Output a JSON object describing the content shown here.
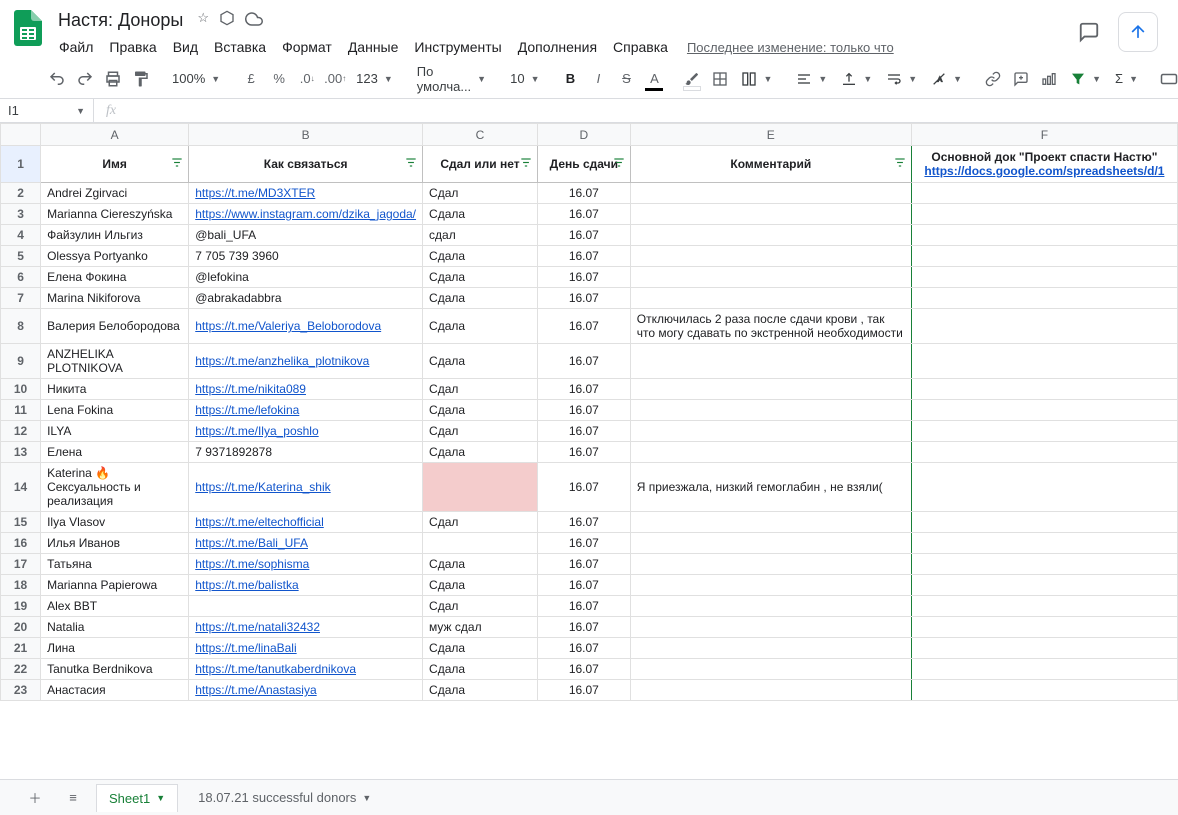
{
  "doc": {
    "title": "Настя: Доноры",
    "last_edit": "Последнее изменение: только что"
  },
  "menus": [
    "Файл",
    "Правка",
    "Вид",
    "Вставка",
    "Формат",
    "Данные",
    "Инструменты",
    "Дополнения",
    "Справка"
  ],
  "toolbar": {
    "zoom": "100%",
    "font": "По умолча...",
    "font_size": "10"
  },
  "formula": {
    "cell_ref": "I1",
    "value": ""
  },
  "columns": [
    "A",
    "B",
    "C",
    "D",
    "E",
    "F"
  ],
  "headers": {
    "A": "Имя",
    "B": "Как связаться",
    "C": "Сдал или нет",
    "D": "День сдачи",
    "E": "Комментарий",
    "F_line1": "Основной док \"Проект спасти Настю\"",
    "F_line2": "https://docs.google.com/spreadsheets/d/1"
  },
  "rows": [
    {
      "n": 2,
      "A": "Andrei Zgirvaci",
      "B": "https://t.me/MD3XTER",
      "B_link": true,
      "C": "Сдал",
      "D": "16.07",
      "E": ""
    },
    {
      "n": 3,
      "A": "Marianna Ciereszyńska",
      "B": "https://www.instagram.com/dzika_jagoda/",
      "B_link": true,
      "C": "Сдала",
      "D": "16.07",
      "E": ""
    },
    {
      "n": 4,
      "A": "Файзулин Ильгиз",
      "B": "@bali_UFA",
      "B_link": false,
      "C": "сдал",
      "D": "16.07",
      "E": ""
    },
    {
      "n": 5,
      "A": "Olessya Portyanko",
      "B": "7 705 739 3960",
      "B_link": false,
      "C": "Сдала",
      "D": "16.07",
      "E": ""
    },
    {
      "n": 6,
      "A": "Елена Фокина",
      "B": "@lefokina",
      "B_link": false,
      "C": "Сдала",
      "D": "16.07",
      "E": ""
    },
    {
      "n": 7,
      "A": "Marina Nikiforova",
      "B": "@abrakadabbra",
      "B_link": false,
      "C": "Сдала",
      "D": "16.07",
      "E": ""
    },
    {
      "n": 8,
      "A": "Валерия Белобородова",
      "B": "https://t.me/Valeriya_Beloborodova",
      "B_link": true,
      "C": "Сдала",
      "D": "16.07",
      "E": "Отключилась 2 раза после сдачи крови , так что могу сдавать по экстренной необходимости"
    },
    {
      "n": 9,
      "A": "ANZHELIKA PLOTNIKOVA",
      "B": "https://t.me/anzhelika_plotnikova",
      "B_link": true,
      "C": "Сдала",
      "D": "16.07",
      "E": ""
    },
    {
      "n": 10,
      "A": "Никита",
      "B": "https://t.me/nikita089",
      "B_link": true,
      "C": "Сдал",
      "D": "16.07",
      "E": ""
    },
    {
      "n": 11,
      "A": "Lena Fokina",
      "B": "https://t.me/lefokina",
      "B_link": true,
      "C": "Сдала",
      "D": "16.07",
      "E": ""
    },
    {
      "n": 12,
      "A": "ILYA",
      "B": "https://t.me/Ilya_poshlo",
      "B_link": true,
      "C": "Сдал",
      "D": "16.07",
      "E": ""
    },
    {
      "n": 13,
      "A": "Елена",
      "B": "7 9371892878",
      "B_link": false,
      "C": "Сдала",
      "D": "16.07",
      "E": ""
    },
    {
      "n": 14,
      "A": "Katerina 🔥Сексуальность и реализация",
      "B": "https://t.me/Katerina_shik",
      "B_link": true,
      "C": "",
      "C_hl": true,
      "D": "16.07",
      "E": "Я приезжала, низкий гемоглабин , не взяли("
    },
    {
      "n": 15,
      "A": "Ilya Vlasov",
      "B": "https://t.me/eltechofficial",
      "B_link": true,
      "C": "Сдал",
      "D": "16.07",
      "E": ""
    },
    {
      "n": 16,
      "A": "Илья Иванов",
      "B": "https://t.me/Bali_UFA",
      "B_link": true,
      "C": "",
      "D": "16.07",
      "E": ""
    },
    {
      "n": 17,
      "A": "Татьяна",
      "B": "https://t.me/sophisma",
      "B_link": true,
      "C": "Сдала",
      "D": "16.07",
      "E": ""
    },
    {
      "n": 18,
      "A": "Marianna Papierowa",
      "B": "https://t.me/balistka",
      "B_link": true,
      "C": "Сдала",
      "D": "16.07",
      "E": ""
    },
    {
      "n": 19,
      "A": "Alex BBT",
      "B": "",
      "B_link": false,
      "C": "Сдал",
      "D": "16.07",
      "E": ""
    },
    {
      "n": 20,
      "A": "Natalia",
      "B": "https://t.me/natali32432",
      "B_link": true,
      "C": "муж сдал",
      "D": "16.07",
      "E": ""
    },
    {
      "n": 21,
      "A": "Лина",
      "B": "https://t.me/linaBali",
      "B_link": true,
      "C": "Сдала",
      "D": "16.07",
      "E": ""
    },
    {
      "n": 22,
      "A": "Tanutka Berdnikova",
      "B": "https://t.me/tanutkaberdnikova",
      "B_link": true,
      "C": "Сдала",
      "D": "16.07",
      "E": ""
    },
    {
      "n": 23,
      "A": "Анастасия",
      "B": "https://t.me/Anastasiya",
      "B_link": true,
      "C": "Сдала",
      "D": "16.07",
      "E": ""
    }
  ],
  "sheets": {
    "active": "Sheet1",
    "other": "18.07.21 successful donors"
  }
}
